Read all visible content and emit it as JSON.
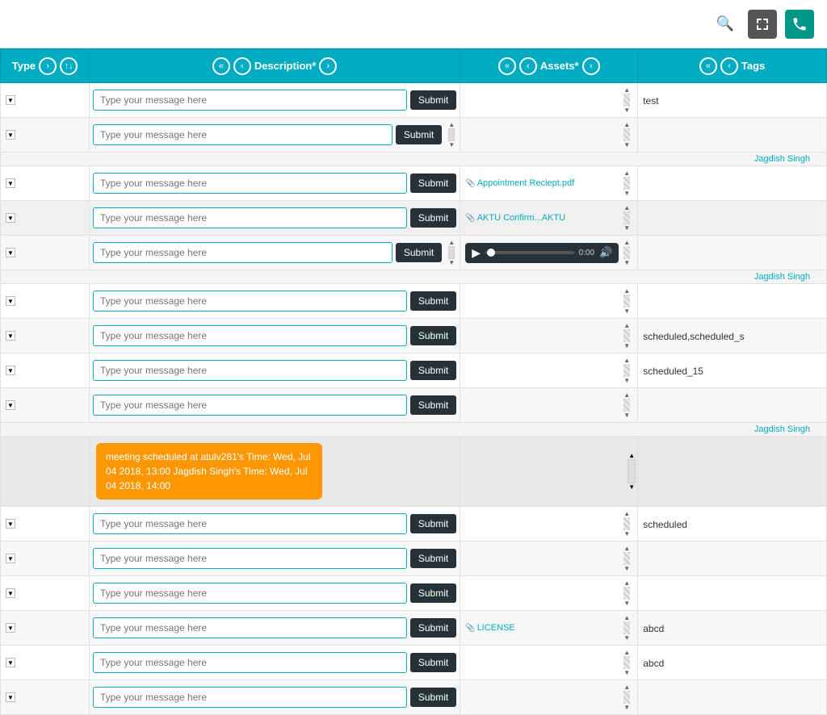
{
  "topbar": {
    "search_icon": "🔍",
    "expand_icon": "⤢",
    "phone_icon": "📞"
  },
  "header": {
    "type_label": "Type",
    "desc_label": "Description*",
    "assets_label": "Assets*",
    "tags_label": "Tags"
  },
  "nav": {
    "prev_double": "«",
    "prev_single": "‹",
    "next_double": "»",
    "next_single": "›",
    "sort_up": "↑",
    "sort_down": "↓"
  },
  "placeholder": "Type your message here",
  "submit_label": "Submit",
  "jagdish_label": "Jagdish Singh",
  "audio": {
    "time": "0:00"
  },
  "rows": [
    {
      "id": 1,
      "tag": "test",
      "asset": "",
      "has_scrollbar": false
    },
    {
      "id": 2,
      "tag": "",
      "asset": "",
      "has_scrollbar": true,
      "group_end": true
    },
    {
      "id": 3,
      "tag": "",
      "asset": "Appointment Reciept.pdf",
      "has_scrollbar": false
    },
    {
      "id": 4,
      "tag": "",
      "asset": "AKTU...",
      "has_scrollbar": false
    },
    {
      "id": 5,
      "tag": "",
      "asset": "audio",
      "has_scrollbar": true,
      "group_end": true
    },
    {
      "id": 6,
      "tag": "",
      "asset": "",
      "has_scrollbar": false
    },
    {
      "id": 7,
      "tag": "scheduled,scheduled_s",
      "asset": "",
      "has_scrollbar": false
    },
    {
      "id": 8,
      "tag": "scheduled_15",
      "asset": "",
      "has_scrollbar": false
    },
    {
      "id": 9,
      "tag": "",
      "asset": "",
      "has_scrollbar": false,
      "group_end": true
    },
    {
      "id": 10,
      "tag": "",
      "asset": "",
      "has_scrollbar": false,
      "meeting": true
    },
    {
      "id": 11,
      "tag": "scheduled",
      "asset": "",
      "has_scrollbar": false
    },
    {
      "id": 12,
      "tag": "",
      "asset": "",
      "has_scrollbar": false
    },
    {
      "id": 13,
      "tag": "",
      "asset": "",
      "has_scrollbar": false
    },
    {
      "id": 14,
      "tag": "abcd",
      "asset": "LICENSE",
      "has_scrollbar": false
    },
    {
      "id": 15,
      "tag": "abcd",
      "asset": "",
      "has_scrollbar": false
    },
    {
      "id": 16,
      "tag": "",
      "asset": "",
      "has_scrollbar": false
    }
  ],
  "meeting_bubble": {
    "text": "meeting scheduled at atulv281's Time: Wed, Jul 04 2018, 13:00 Jagdish Singh's Time: Wed, Jul 04 2018, 14:00"
  }
}
